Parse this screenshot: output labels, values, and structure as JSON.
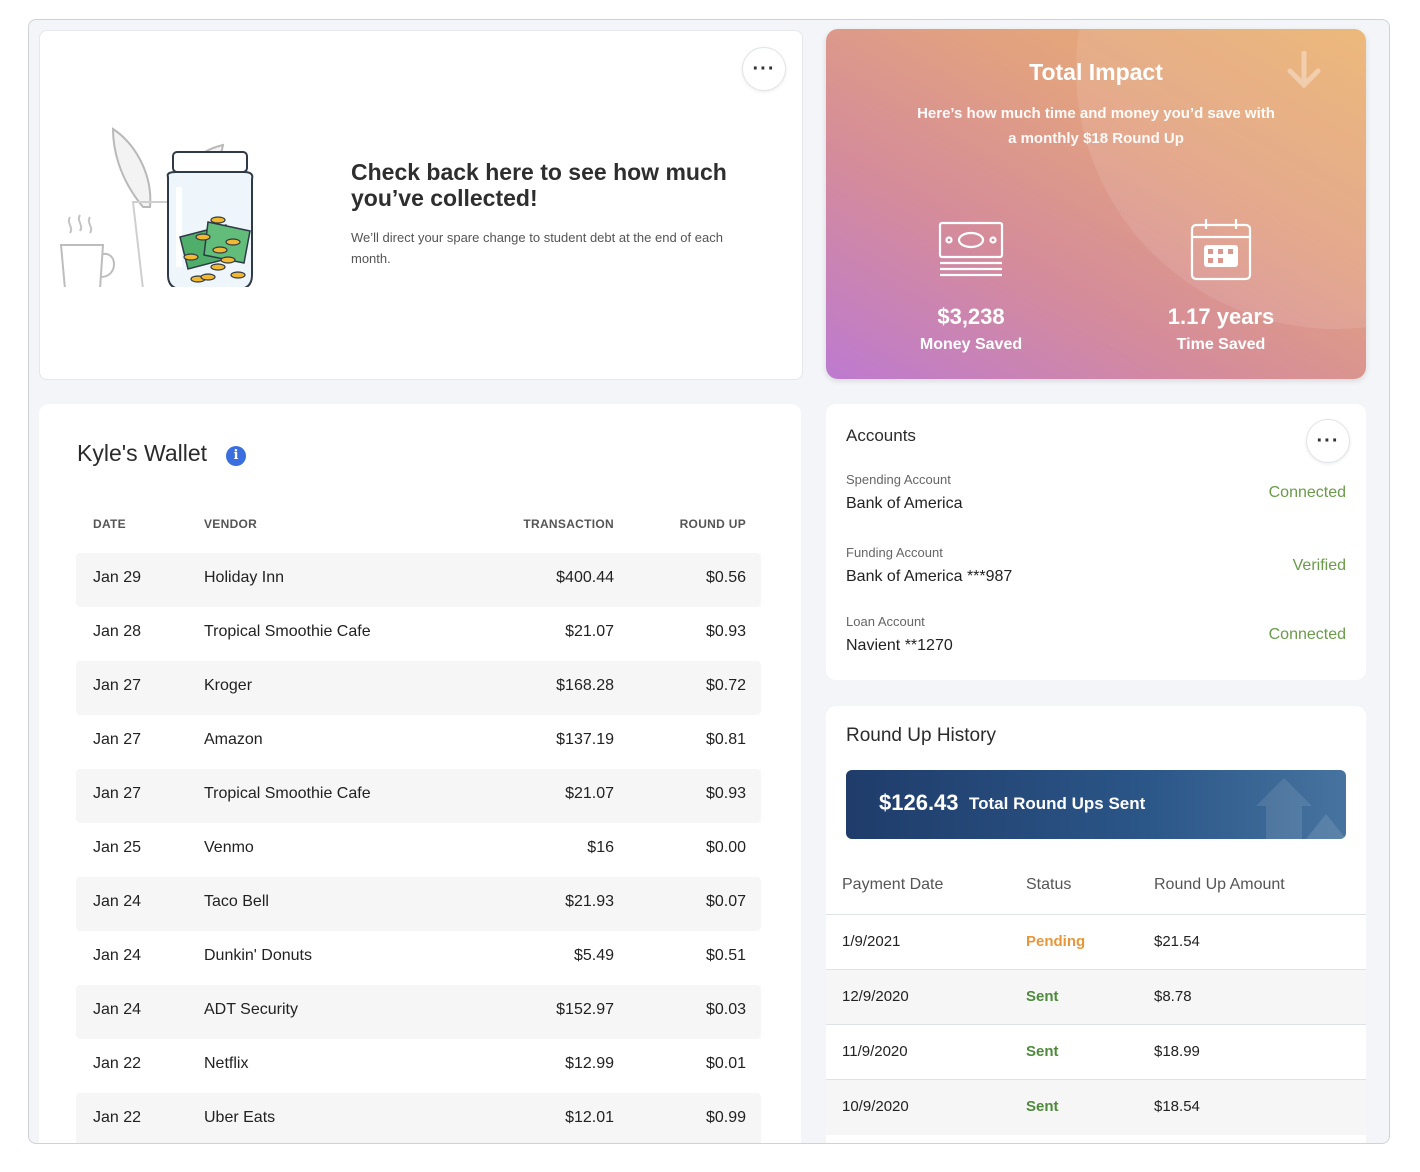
{
  "collected": {
    "heading": "Check back here to see how much you’ve collected!",
    "body": "We’ll direct your spare change to student debt at the end of each month.",
    "more_label": "···"
  },
  "impact": {
    "title": "Total Impact",
    "subtitle": "Here’s how much time and money you’d save with a monthly $18 Round Up",
    "money_value": "$3,238",
    "money_label": "Money Saved",
    "time_value": "1.17 years",
    "time_label": "Time Saved",
    "icons": [
      "money-stack-icon",
      "calendar-icon",
      "arrow-down-icon"
    ]
  },
  "wallet": {
    "title": "Kyle's Wallet",
    "info_icon": "i",
    "columns": [
      "DATE",
      "VENDOR",
      "TRANSACTION",
      "ROUND UP"
    ],
    "rows": [
      {
        "date": "Jan 29",
        "vendor": "Holiday Inn",
        "amount": "$400.44",
        "roundup": "$0.56"
      },
      {
        "date": "Jan 28",
        "vendor": "Tropical Smoothie Cafe",
        "amount": "$21.07",
        "roundup": "$0.93"
      },
      {
        "date": "Jan 27",
        "vendor": "Kroger",
        "amount": "$168.28",
        "roundup": "$0.72"
      },
      {
        "date": "Jan 27",
        "vendor": "Amazon",
        "amount": "$137.19",
        "roundup": "$0.81"
      },
      {
        "date": "Jan 27",
        "vendor": "Tropical Smoothie Cafe",
        "amount": "$21.07",
        "roundup": "$0.93"
      },
      {
        "date": "Jan 25",
        "vendor": "Venmo",
        "amount": "$16",
        "roundup": "$0.00"
      },
      {
        "date": "Jan 24",
        "vendor": "Taco Bell",
        "amount": "$21.93",
        "roundup": "$0.07"
      },
      {
        "date": "Jan 24",
        "vendor": "Dunkin' Donuts",
        "amount": "$5.49",
        "roundup": "$0.51"
      },
      {
        "date": "Jan 24",
        "vendor": "ADT Security",
        "amount": "$152.97",
        "roundup": "$0.03"
      },
      {
        "date": "Jan 22",
        "vendor": "Netflix",
        "amount": "$12.99",
        "roundup": "$0.01"
      },
      {
        "date": "Jan 22",
        "vendor": "Uber Eats",
        "amount": "$12.01",
        "roundup": "$0.99"
      }
    ]
  },
  "accounts": {
    "title": "Accounts",
    "more_label": "···",
    "items": [
      {
        "label": "Spending Account",
        "value": "Bank of America",
        "status": "Connected"
      },
      {
        "label": "Funding Account",
        "value": "Bank of America ***987",
        "status": "Verified"
      },
      {
        "label": "Loan Account",
        "value": "Navient **1270",
        "status": "Connected"
      }
    ],
    "status_color": "#6a9b4a"
  },
  "history": {
    "title": "Round Up History",
    "total_amount": "$126.43",
    "total_label": "Total Round Ups Sent",
    "columns": [
      "Payment Date",
      "Status",
      "Round Up Amount"
    ],
    "rows": [
      {
        "date": "1/9/2021",
        "status": "Pending",
        "amount": "$21.54"
      },
      {
        "date": "12/9/2020",
        "status": "Sent",
        "amount": "$8.78"
      },
      {
        "date": "11/9/2020",
        "status": "Sent",
        "amount": "$18.99"
      },
      {
        "date": "10/9/2020",
        "status": "Sent",
        "amount": "$18.54"
      }
    ],
    "pending_color": "#e8963a",
    "sent_color": "#4f8a3c"
  }
}
